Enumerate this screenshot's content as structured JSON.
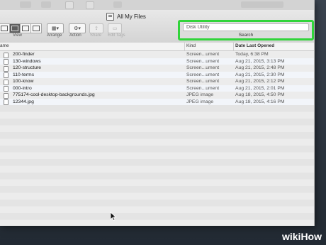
{
  "window": {
    "title": "All My Files"
  },
  "toolbar": {
    "view_label": "View",
    "arrange_label": "Arrange",
    "action_label": "Action",
    "share_label": "Share",
    "edit_tags_label": "Edit Tags"
  },
  "search": {
    "value": "Disk Utility",
    "label": "Search",
    "highlight_color": "#31d43a"
  },
  "columns": {
    "name": "ame",
    "kind": "Kind",
    "date": "Date Last Opened"
  },
  "files": [
    {
      "name": "200-finder",
      "kind": "Screen...ument",
      "date": "Today, 6:38 PM"
    },
    {
      "name": "130-windows",
      "kind": "Screen...ument",
      "date": "Aug 21, 2015, 3:13 PM"
    },
    {
      "name": "120-structure",
      "kind": "Screen...ument",
      "date": "Aug 21, 2015, 2:48 PM"
    },
    {
      "name": "110-terms",
      "kind": "Screen...ument",
      "date": "Aug 21, 2015, 2:30 PM"
    },
    {
      "name": "100-know",
      "kind": "Screen...ument",
      "date": "Aug 21, 2015, 2:12 PM"
    },
    {
      "name": "000-intro",
      "kind": "Screen...ument",
      "date": "Aug 21, 2015, 2:01 PM"
    },
    {
      "name": "775174-cool-desktop-backgrounds.jpg",
      "kind": "JPEG image",
      "date": "Aug 18, 2015, 4:50 PM"
    },
    {
      "name": "12344.jpg",
      "kind": "JPEG image",
      "date": "Aug 18, 2015, 4:16 PM"
    }
  ],
  "watermark": {
    "wiki": "wiki",
    "how": "How"
  }
}
